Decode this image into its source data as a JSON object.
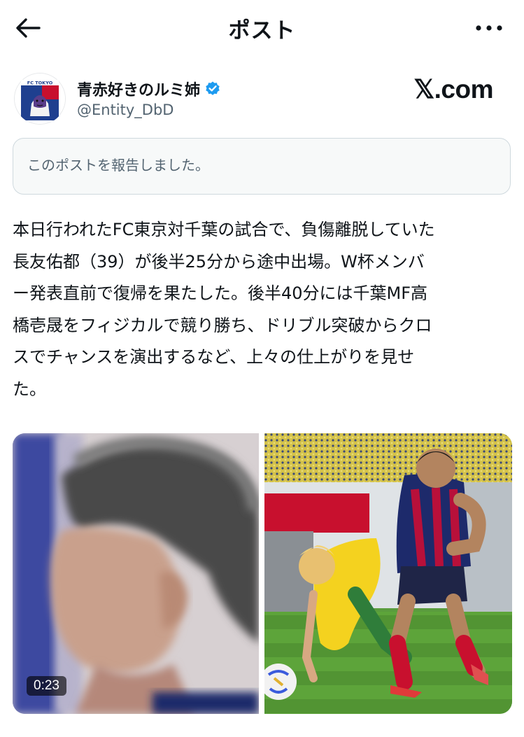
{
  "header": {
    "title": "ポスト",
    "back_icon": "arrow-left-icon",
    "more_icon": "more-horizontal-icon"
  },
  "author": {
    "display_name": "青赤好きのルミ姉",
    "handle": "@Entity_DbD",
    "verified_icon": "verified-badge-icon",
    "verified_color": "#1d9bf0",
    "avatar_text": "FC TOKYO"
  },
  "brand": {
    "logo_text": "𝕏.com"
  },
  "report_notice": {
    "text": "このポストを報告しました。"
  },
  "post": {
    "lines": [
      "本日行われたFC東京対千葉の試合で、負傷離脱していた",
      "長友佑都（39）が後半25分から途中出場。W杯メンバ",
      "ー発表直前で復帰を果たした。後半40分には千葉MF高",
      "橋壱晟をフィジカルで競り勝ち、ドリブル突破からクロ",
      "スでチャンスを演出するなど、上々の仕上がりを見せ",
      "た。"
    ]
  },
  "media": {
    "video_duration": "0:23"
  },
  "colors": {
    "text_primary": "#0f1419",
    "text_secondary": "#536471",
    "border": "#cfd9de",
    "report_bg": "#f7f9f9"
  }
}
